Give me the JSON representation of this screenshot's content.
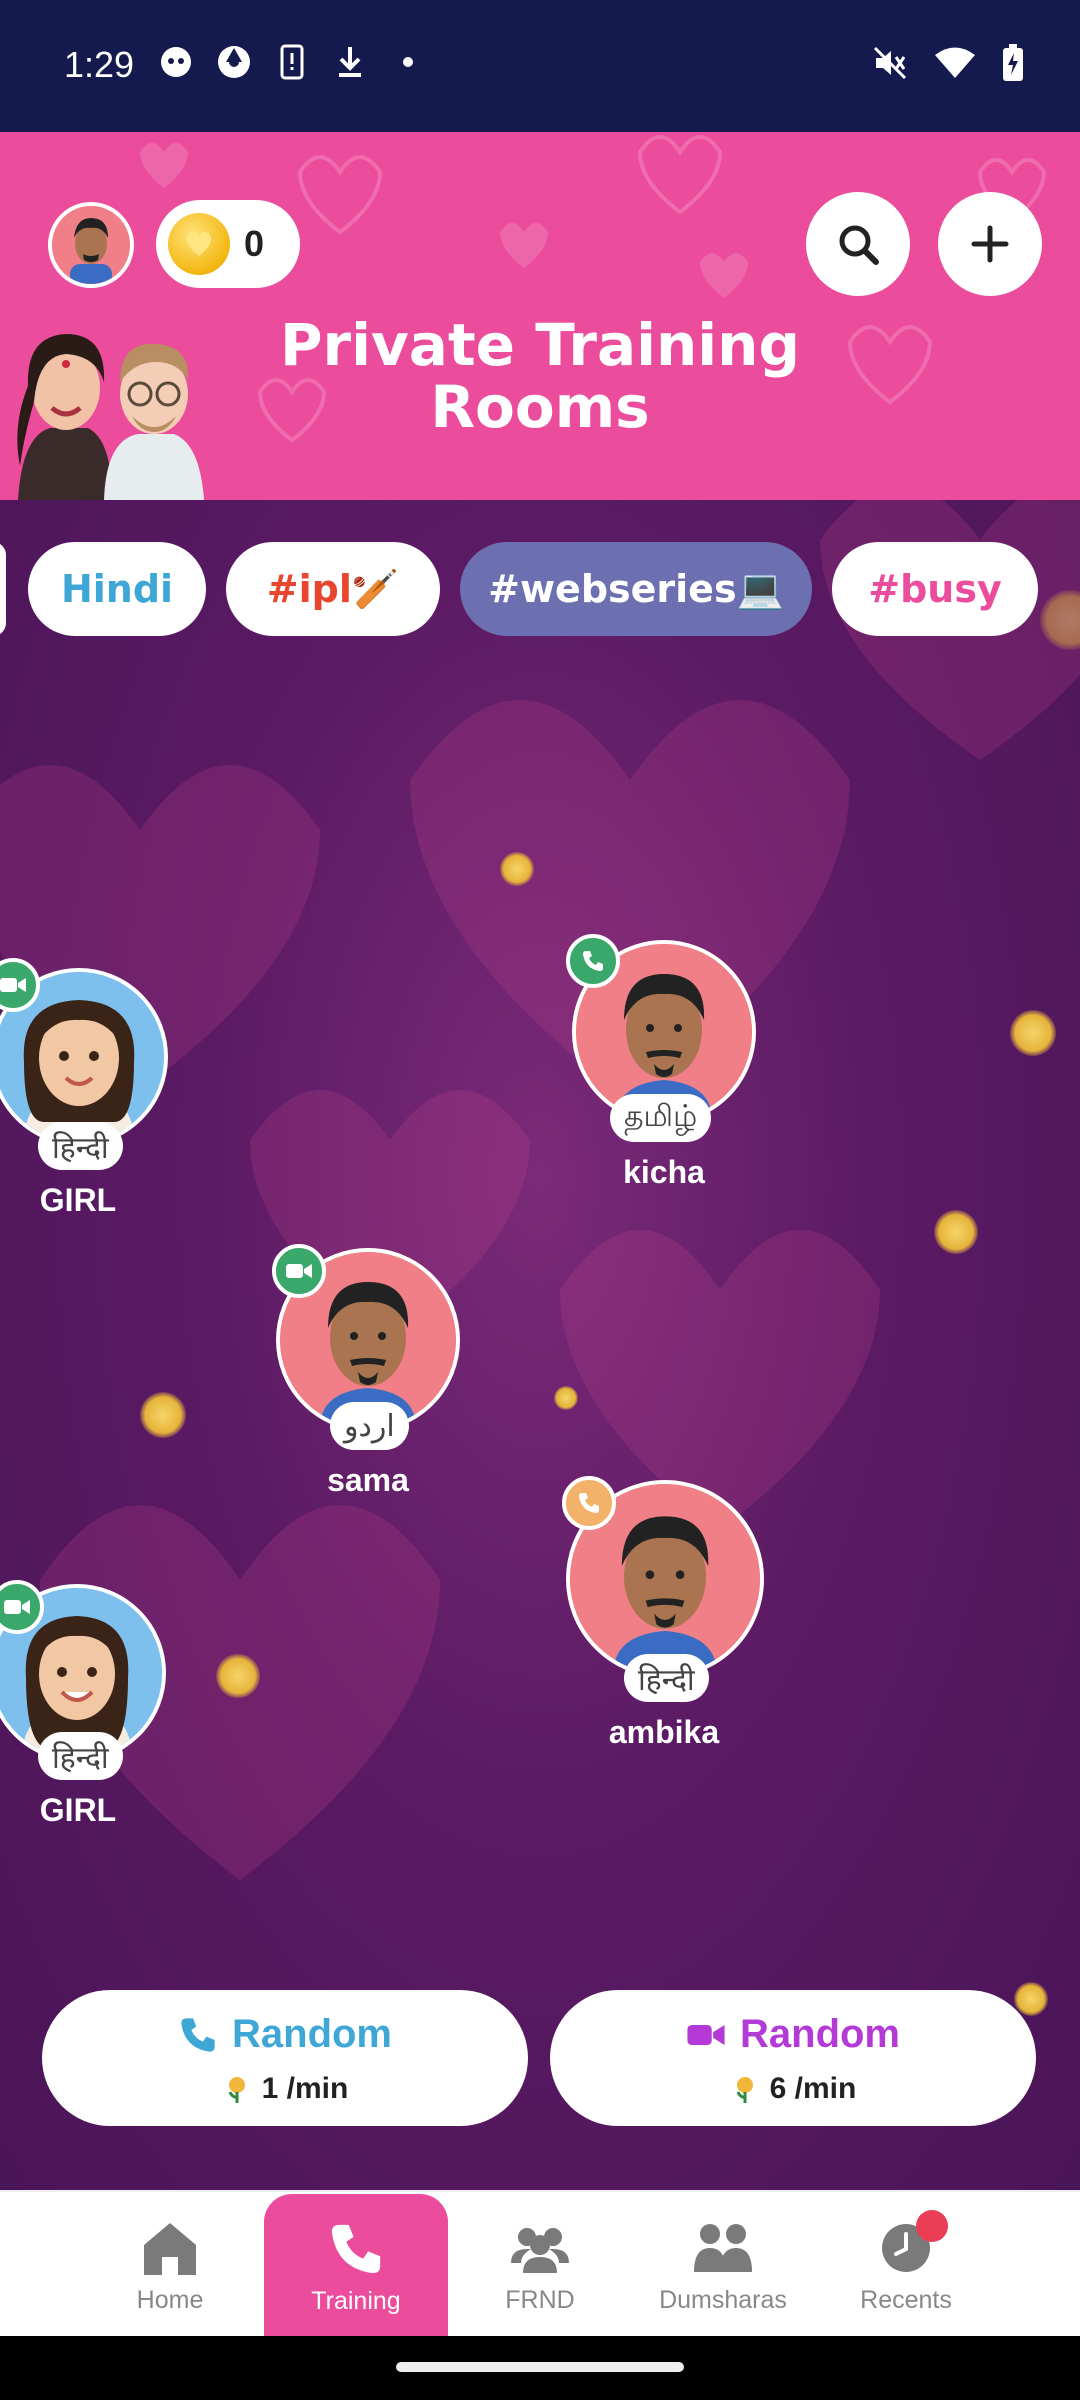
{
  "status_bar": {
    "time": "1:29"
  },
  "header": {
    "coins": "0",
    "title_line1": "Private Training",
    "title_line2": "Rooms"
  },
  "tags": [
    {
      "label": "Hindi",
      "color": "#3ea7d6"
    },
    {
      "label": "#ipl🏏",
      "color": "#e8462e"
    },
    {
      "label": "#webseries💻",
      "color": "#ffffff",
      "selected": true
    },
    {
      "label": "#busy",
      "color": "#ec4c9c"
    }
  ],
  "users": [
    {
      "name": "GIRL",
      "language": "हिन्दी",
      "call_type": "video"
    },
    {
      "name": "kicha",
      "language": "தமிழ்",
      "call_type": "audio"
    },
    {
      "name": "sama",
      "language": "اردو",
      "call_type": "video"
    },
    {
      "name": "ambika",
      "language": "हिन्दी",
      "call_type": "audio"
    },
    {
      "name": "GIRL",
      "language": "हिन्दी",
      "call_type": "video"
    }
  ],
  "random_buttons": {
    "audio": {
      "label": "Random",
      "rate": "1 /min",
      "color": "#3ea7d6"
    },
    "video": {
      "label": "Random",
      "rate": "6 /min",
      "color": "#b43ad8"
    }
  },
  "nav": {
    "items": [
      {
        "label": "Home"
      },
      {
        "label": "Training",
        "active": true
      },
      {
        "label": "FRND"
      },
      {
        "label": "Dumsharas"
      },
      {
        "label": "Recents"
      }
    ]
  },
  "colors": {
    "header_pink": "#ec4c9c",
    "main_purple": "#5b1a64",
    "video_badge": "#3aa86b",
    "audio_badge_green": "#3aa86b",
    "audio_badge_orange": "#f2b26a"
  }
}
